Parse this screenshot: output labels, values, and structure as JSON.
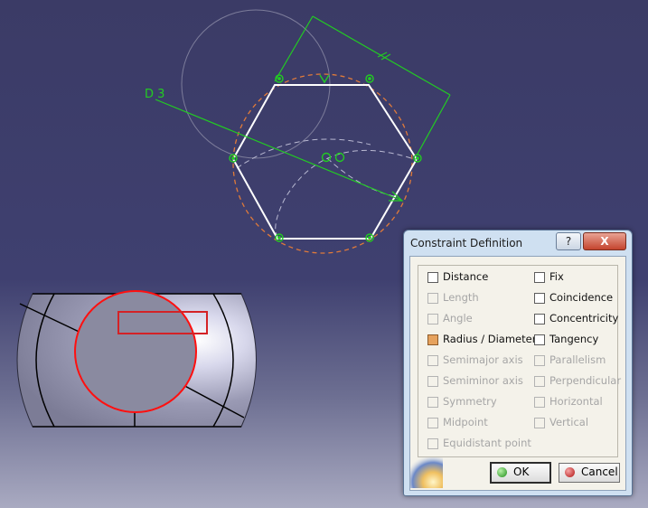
{
  "sketch": {
    "dimension_label": "D 3"
  },
  "dialog": {
    "title": "Constraint Definition",
    "help_label": "?",
    "close_label": "X",
    "left_options": [
      {
        "label": "Distance",
        "state": "enabled"
      },
      {
        "label": "Length",
        "state": "disabled"
      },
      {
        "label": "Angle",
        "state": "disabled"
      },
      {
        "label": "Radius / Diameter",
        "state": "selected"
      },
      {
        "label": "Semimajor axis",
        "state": "disabled"
      },
      {
        "label": "Semiminor axis",
        "state": "disabled"
      },
      {
        "label": "Symmetry",
        "state": "disabled"
      },
      {
        "label": "Midpoint",
        "state": "disabled"
      },
      {
        "label": "Equidistant point",
        "state": "disabled"
      }
    ],
    "right_options": [
      {
        "label": "Fix",
        "state": "enabled"
      },
      {
        "label": "Coincidence",
        "state": "enabled"
      },
      {
        "label": "Concentricity",
        "state": "enabled",
        "highlighted": true
      },
      {
        "label": "Tangency",
        "state": "enabled"
      },
      {
        "label": "Parallelism",
        "state": "disabled"
      },
      {
        "label": "Perpendicular",
        "state": "disabled"
      },
      {
        "label": "Horizontal",
        "state": "disabled"
      },
      {
        "label": "Vertical",
        "state": "disabled"
      }
    ],
    "ok_label": "OK",
    "cancel_label": "Cancel"
  },
  "colors": {
    "background": "#3f4070",
    "sketch_geometry": "#ffffff",
    "constraint": "#22cc22",
    "construction_circle": "#e07a3a",
    "highlight": "#d42226",
    "part_edge": "#ff1010"
  }
}
